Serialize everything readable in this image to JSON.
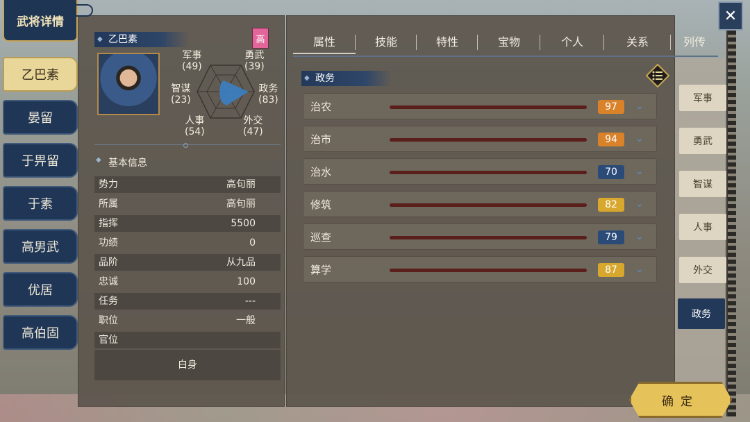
{
  "window": {
    "title": "武将详情",
    "close_icon": "close-icon"
  },
  "officer_list": [
    {
      "name": "乙巴素",
      "active": true
    },
    {
      "name": "晏留",
      "active": false
    },
    {
      "name": "于畀留",
      "active": false
    },
    {
      "name": "于素",
      "active": false
    },
    {
      "name": "高男武",
      "active": false
    },
    {
      "name": "优居",
      "active": false
    },
    {
      "name": "高伯固",
      "active": false
    }
  ],
  "officer": {
    "name": "乙巴素",
    "rank_badge": "高",
    "stats": {
      "military": {
        "label": "军事",
        "value": "(49)"
      },
      "valor": {
        "label": "勇武",
        "value": "(39)"
      },
      "strategy": {
        "label": "智谋",
        "value": "(23)"
      },
      "politics": {
        "label": "政务",
        "value": "(83)"
      },
      "personnel": {
        "label": "人事",
        "value": "(54)"
      },
      "diplomacy": {
        "label": "外交",
        "value": "(47)"
      }
    }
  },
  "basic_info": {
    "title": "基本信息",
    "rows": [
      {
        "label": "势力",
        "value": "高句丽"
      },
      {
        "label": "所属",
        "value": "高句丽"
      },
      {
        "label": "指挥",
        "value": "5500"
      },
      {
        "label": "功绩",
        "value": "0"
      },
      {
        "label": "品阶",
        "value": "从九品"
      },
      {
        "label": "忠诚",
        "value": "100"
      },
      {
        "label": "任务",
        "value": "---"
      },
      {
        "label": "职位",
        "value": "一般"
      },
      {
        "label": "官位",
        "value": ""
      }
    ],
    "rank_text": "白身"
  },
  "tabs": [
    "属性",
    "技能",
    "特性",
    "宝物",
    "个人",
    "关系",
    "列传"
  ],
  "section": {
    "title": "政务",
    "abilities": [
      {
        "name": "治农",
        "value": 97,
        "color": "#d9822a"
      },
      {
        "name": "治市",
        "value": 94,
        "color": "#d9822a"
      },
      {
        "name": "治水",
        "value": 70,
        "color": "#2a4a78"
      },
      {
        "name": "修筑",
        "value": 82,
        "color": "#d8a82e"
      },
      {
        "name": "巡查",
        "value": 79,
        "color": "#2a4a78"
      },
      {
        "name": "算学",
        "value": 87,
        "color": "#d8a82e"
      }
    ]
  },
  "side_tabs": [
    {
      "label": "军事",
      "active": false
    },
    {
      "label": "勇武",
      "active": false
    },
    {
      "label": "智谋",
      "active": false
    },
    {
      "label": "人事",
      "active": false
    },
    {
      "label": "外交",
      "active": false
    },
    {
      "label": "政务",
      "active": true
    }
  ],
  "confirm_label": "确定"
}
